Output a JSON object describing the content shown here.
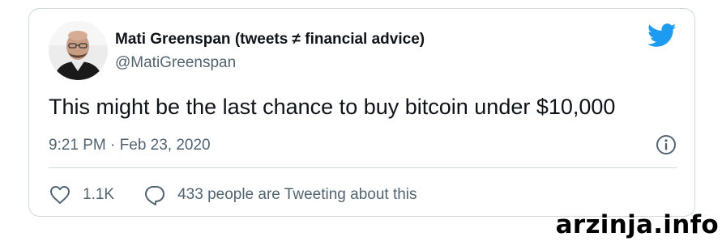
{
  "tweet": {
    "author": {
      "display_name": "Mati Greenspan (tweets ≠ financial advice)",
      "handle": "@MatiGreenspan"
    },
    "text": "This might be the last chance to buy bitcoin under $10,000",
    "timestamp": "9:21 PM · Feb 23, 2020",
    "actions": {
      "likes": "1.1K",
      "discussion": "433 people are Tweeting about this"
    }
  },
  "watermark": "arzinja.info",
  "icons": {
    "brand": "twitter-bird-icon",
    "info": "info-icon",
    "like": "heart-icon",
    "reply": "speech-bubble-icon"
  },
  "colors": {
    "brand_blue": "#1d9bf0",
    "text_primary": "#0f1419",
    "text_secondary": "#536471",
    "border": "#cfd9de"
  }
}
